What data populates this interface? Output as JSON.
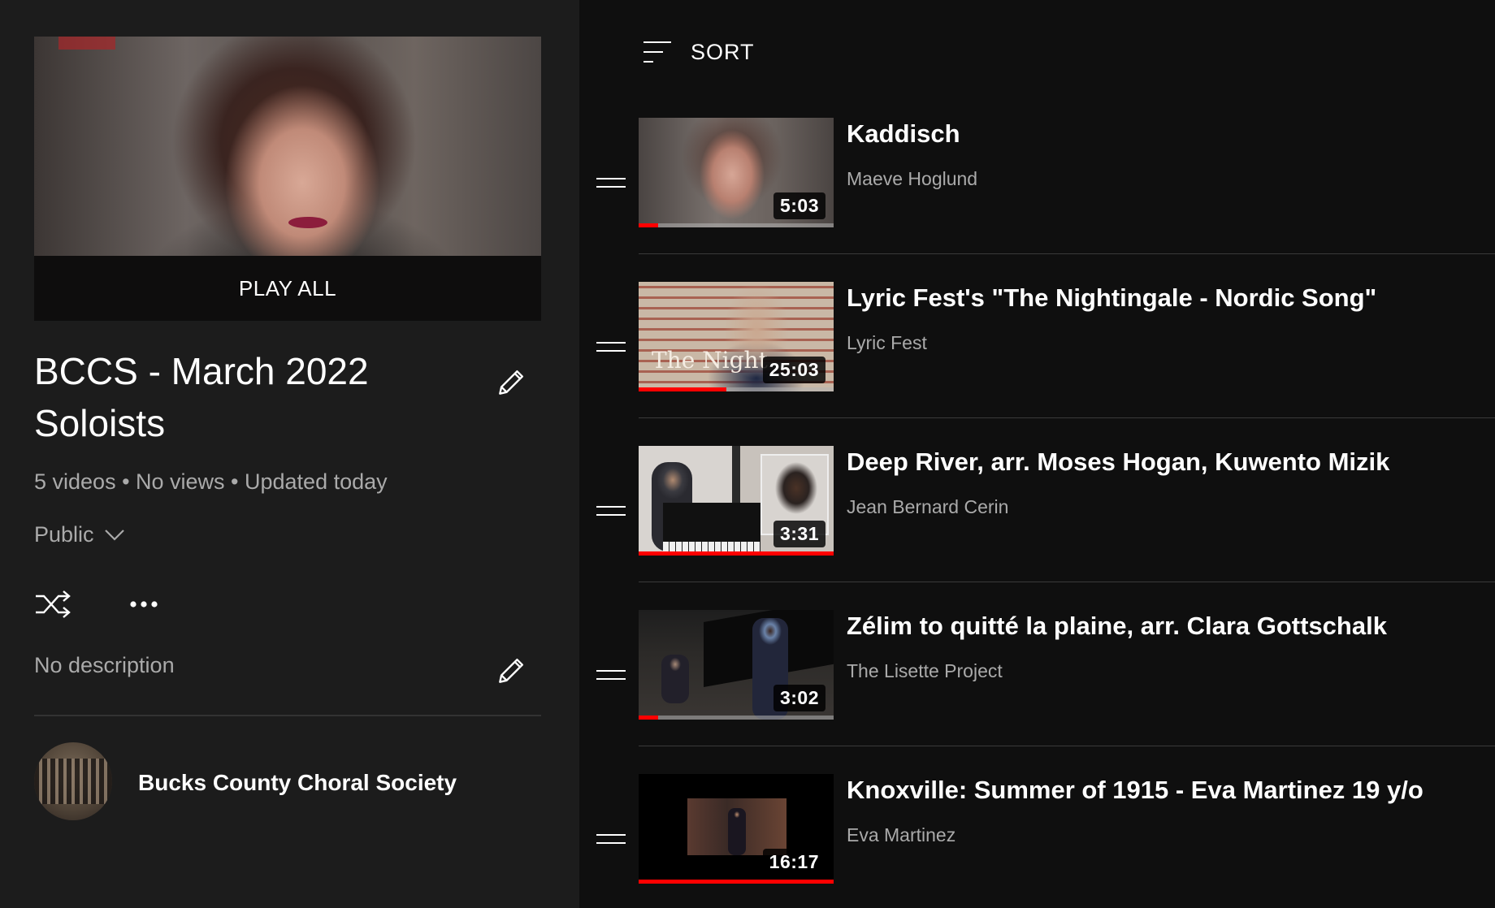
{
  "playlist": {
    "play_all_label": "PLAY ALL",
    "title": "BCCS - March 2022 Soloists",
    "stats": "5 videos • No views • Updated today",
    "privacy": "Public",
    "description": "No description",
    "channel_name": "Bucks County Choral Society",
    "icons": {
      "edit_title": "pencil-icon",
      "edit_description": "pencil-icon",
      "shuffle": "shuffle-icon",
      "more": "more-horizontal-icon",
      "privacy_dropdown": "chevron-down-icon"
    }
  },
  "sort": {
    "label": "SORT",
    "icon": "sort-lines-icon"
  },
  "videos": [
    {
      "title": "Kaddisch",
      "channel": "Maeve Hoglund",
      "duration": "5:03",
      "progress": 0.1
    },
    {
      "title": "Lyric Fest's \"The Nightingale - Nordic Song\"",
      "channel": "Lyric Fest",
      "duration": "25:03",
      "progress": 0.45,
      "thumb_text": "The Night"
    },
    {
      "title": "Deep River, arr. Moses Hogan, Kuwento Mizik",
      "channel": "Jean Bernard Cerin",
      "duration": "3:31",
      "progress": 1.0
    },
    {
      "title": "Zélim to quitté la plaine, arr. Clara Gottschalk",
      "channel": "The Lisette Project",
      "duration": "3:02",
      "progress": 0.1
    },
    {
      "title": "Knoxville: Summer of 1915 - Eva Martinez 19 y/o",
      "channel": "Eva Martinez",
      "duration": "16:17",
      "progress": 1.0
    }
  ],
  "colors": {
    "background": "#0f0f0f",
    "panel": "#1c1c1c",
    "progress": "#ff0000",
    "secondary_text": "#aaaaaa"
  }
}
